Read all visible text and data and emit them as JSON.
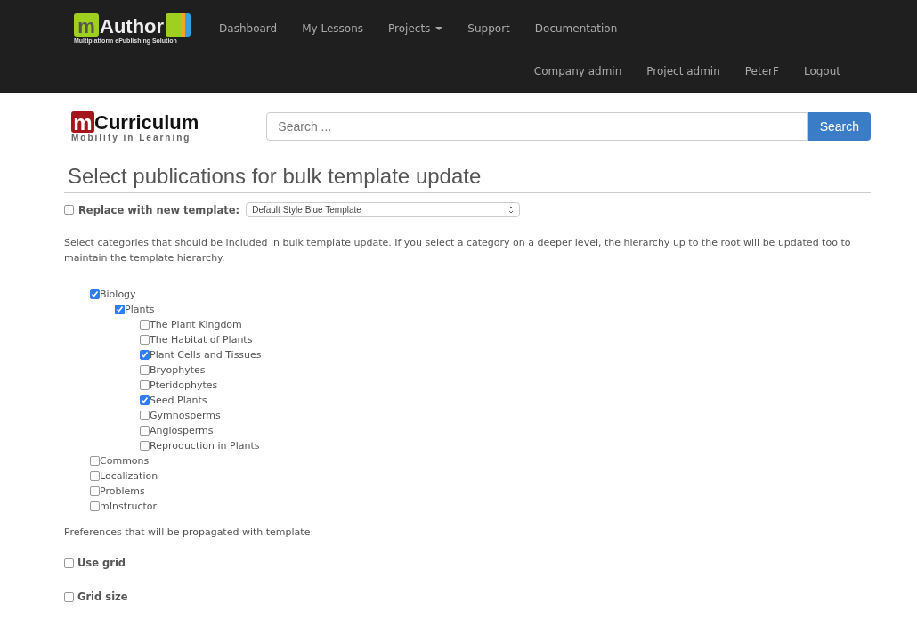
{
  "navbar": {
    "logo": {
      "mark": "m",
      "name": "Author",
      "tagline": "Multiplatform ePublishing Solution"
    },
    "items": [
      {
        "label": "Dashboard",
        "dropdown": false
      },
      {
        "label": "My Lessons",
        "dropdown": false
      },
      {
        "label": "Projects",
        "dropdown": true
      },
      {
        "label": "Support",
        "dropdown": false
      },
      {
        "label": "Documentation",
        "dropdown": false
      }
    ],
    "user_items": [
      "Company admin",
      "Project admin",
      "PeterF",
      "Logout"
    ]
  },
  "header": {
    "logo": {
      "mark": "m",
      "name": "Curriculum",
      "tagline": "Mobility in Learning"
    },
    "search": {
      "placeholder": "Search ...",
      "button": "Search"
    }
  },
  "title": "Select publications for bulk template update",
  "replace_template": {
    "label": "Replace with new template:",
    "checked": false,
    "value": "Default Style Blue Template"
  },
  "description": "Select categories that should be included in bulk template update. If you select a category on a deeper level, the hierarchy up to the root will be updated too to maintain the template hierarchy.",
  "categories": [
    {
      "label": "Biology",
      "checked": true,
      "children": [
        {
          "label": "Plants",
          "checked": true,
          "children": [
            {
              "label": "The Plant Kingdom",
              "checked": false
            },
            {
              "label": "The Habitat of Plants",
              "checked": false
            },
            {
              "label": "Plant Cells and Tissues",
              "checked": true
            },
            {
              "label": "Bryophytes",
              "checked": false
            },
            {
              "label": "Pteridophytes",
              "checked": false
            },
            {
              "label": "Seed Plants",
              "checked": true
            },
            {
              "label": "Gymnosperms",
              "checked": false
            },
            {
              "label": "Angiosperms",
              "checked": false
            },
            {
              "label": "Reproduction in Plants",
              "checked": false
            }
          ]
        }
      ]
    },
    {
      "label": "Commons",
      "checked": false
    },
    {
      "label": "Localization",
      "checked": false
    },
    {
      "label": "Problems",
      "checked": false
    },
    {
      "label": "mInstructor",
      "checked": false
    }
  ],
  "preferences_label": "Preferences that will be propagated with template:",
  "preferences": [
    {
      "label": "Use grid",
      "checked": false
    },
    {
      "label": "Grid size",
      "checked": false
    }
  ]
}
